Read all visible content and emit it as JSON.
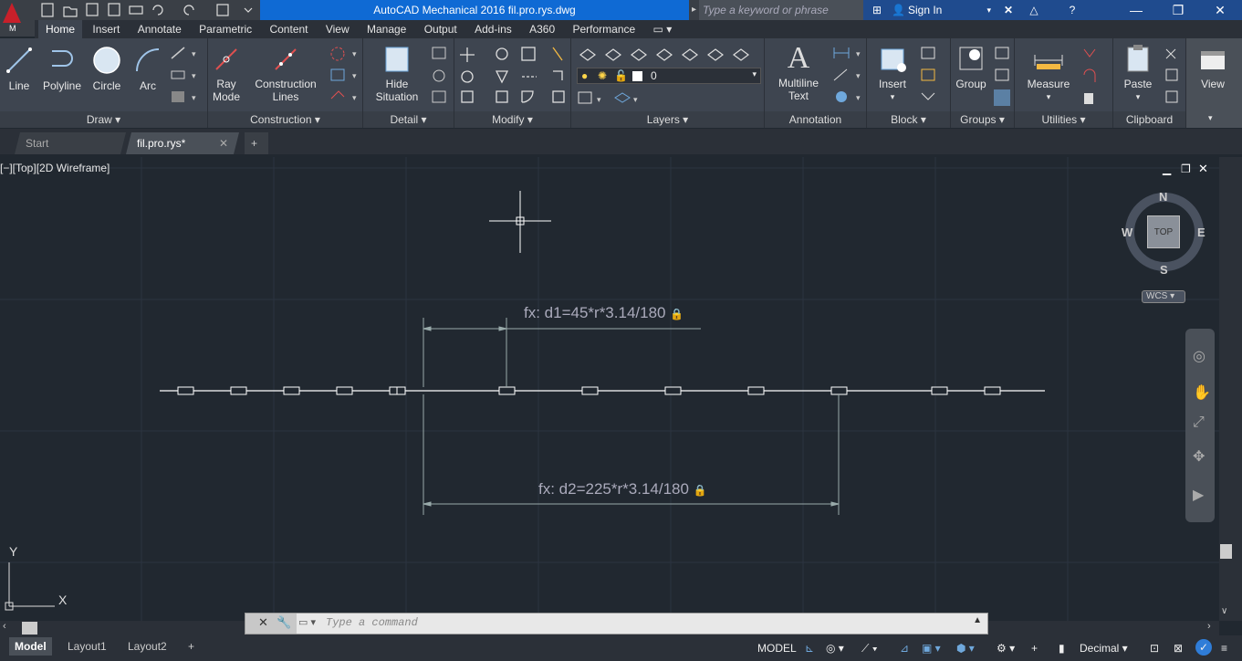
{
  "app": {
    "logo_letter": "M",
    "title": "AutoCAD Mechanical 2016   fil.pro.rys.dwg",
    "search_placeholder": "Type a keyword or phrase",
    "sign_in": "Sign In"
  },
  "ribbon_tabs": [
    "Home",
    "Insert",
    "Annotate",
    "Parametric",
    "Content",
    "View",
    "Manage",
    "Output",
    "Add-ins",
    "A360",
    "Performance"
  ],
  "panels": {
    "draw": {
      "title": "Draw",
      "tools": [
        "Line",
        "Polyline",
        "Circle",
        "Arc"
      ]
    },
    "construction": {
      "title": "Construction",
      "ray_mode": "Ray\nMode",
      "construction_lines": "Construction\nLines"
    },
    "detail": {
      "title": "Detail",
      "hide_situation": "Hide\nSituation"
    },
    "modify": {
      "title": "Modify"
    },
    "layers": {
      "title": "Layers",
      "current_layer": "0"
    },
    "annotation": {
      "title": "Annotation",
      "multiline_text": "Multiline\nText"
    },
    "block": {
      "title": "Block",
      "insert": "Insert"
    },
    "groups": {
      "title": "Groups",
      "group": "Group"
    },
    "utilities": {
      "title": "Utilities",
      "measure": "Measure"
    },
    "clipboard": {
      "title": "Clipboard",
      "paste": "Paste"
    },
    "view": {
      "label": "View"
    }
  },
  "doc_tabs": {
    "start": "Start",
    "active": "fil.pro.rys*"
  },
  "viewport": {
    "label": "[−][Top][2D Wireframe]",
    "dim1": "fx: d1=45*r*3.14/180",
    "dim2": "fx: d2=225*r*3.14/180",
    "viewcube": {
      "n": "N",
      "s": "S",
      "e": "E",
      "w": "W",
      "face": "TOP",
      "wcs": "WCS"
    },
    "ucs": {
      "x": "X",
      "y": "Y"
    }
  },
  "command": {
    "placeholder": "Type  a  command"
  },
  "layout_tabs": [
    "Model",
    "Layout1",
    "Layout2"
  ],
  "status": {
    "model": "MODEL",
    "units": "Decimal"
  }
}
